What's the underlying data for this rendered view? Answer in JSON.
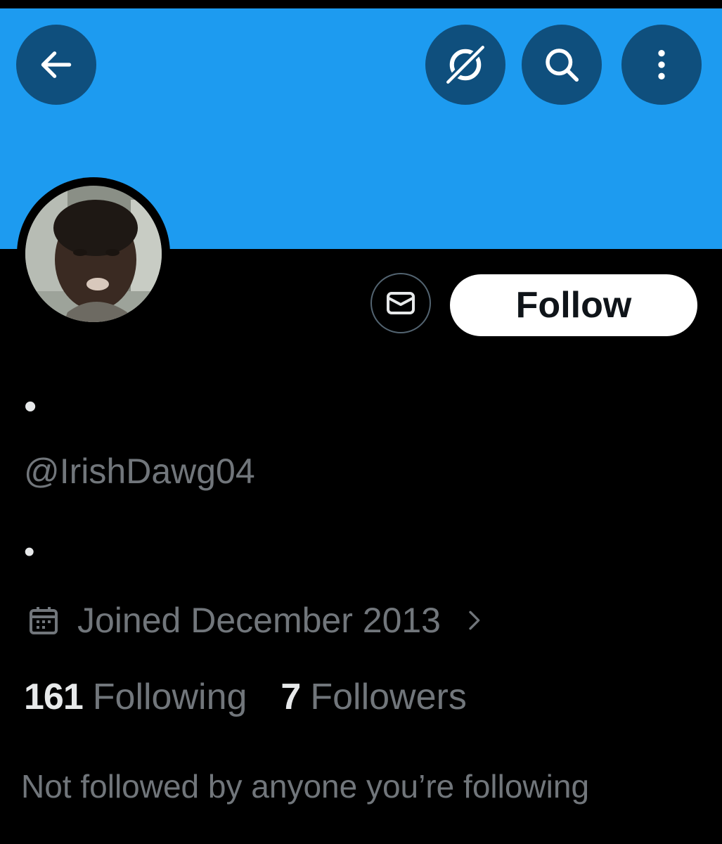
{
  "header": {
    "back_icon": "arrow-left-icon",
    "grok_icon": "grok-icon",
    "search_icon": "search-icon",
    "more_icon": "more-vertical-icon",
    "banner_color": "#1d9bf0"
  },
  "profile": {
    "display_name": "•",
    "handle": "@IrishDawg04",
    "bio": "•",
    "joined": "Joined December 2013",
    "following_count": "161",
    "following_label": "Following",
    "followers_count": "7",
    "followers_label": "Followers",
    "mutuals_text": "Not followed by anyone you’re following"
  },
  "actions": {
    "message_icon": "envelope-icon",
    "follow_label": "Follow"
  },
  "colors": {
    "background": "#000000",
    "primary_text": "#e7e9ea",
    "secondary_text": "#71767b",
    "header_button": "#0f4f7d"
  }
}
